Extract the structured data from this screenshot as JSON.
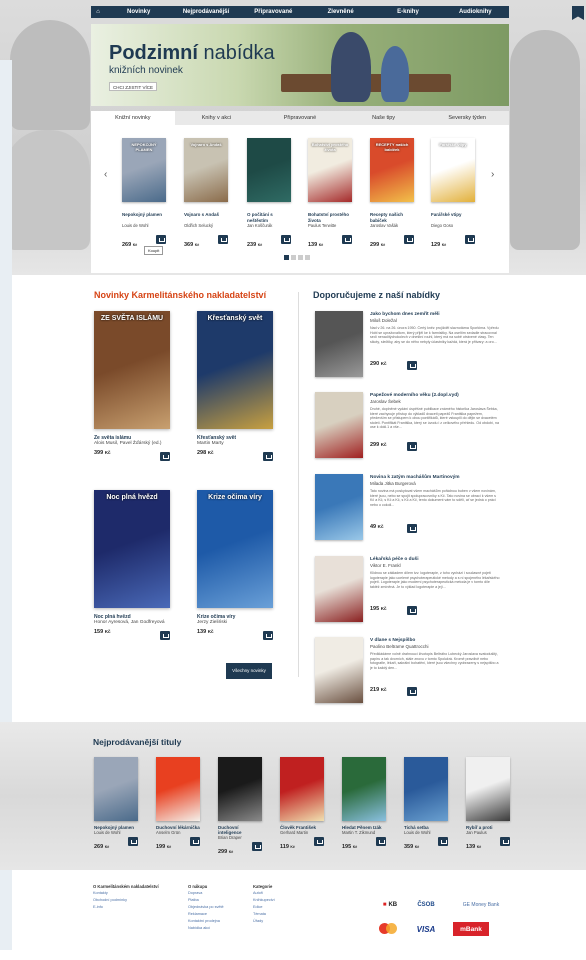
{
  "nav": {
    "items": [
      "Novinky",
      "Nejprodávanější",
      "Připravované",
      "Zlevněné",
      "E-knihy",
      "Audioknihy"
    ]
  },
  "hero": {
    "title_bold": "Podzimní",
    "title_rest": "nabídka",
    "subtitle": "knižních novinek",
    "button": "CHCI ZJISTIT VÍCE"
  },
  "tabs": [
    "Knižní novinky",
    "Knihy v akci",
    "Připravované",
    "Naše tipy",
    "Seversky týden"
  ],
  "carousel": {
    "prev": "‹",
    "next": "›",
    "items": [
      {
        "title": "Nepokojný plamen",
        "author": "Louis de Wohl",
        "price": "269",
        "colors": [
          "#9aa6b8",
          "#4a6a8a"
        ],
        "cover_text": "NEPOKOJNÝ PLAMEN"
      },
      {
        "title": "Vojnaro s Andaš",
        "author": "Oldřich Selucký",
        "price": "369",
        "colors": [
          "#c8c2b2",
          "#8a6b4a"
        ],
        "cover_text": "Vojnaro s Andaš"
      },
      {
        "title": "O počítání s neštěstím",
        "author": "Jan Koščurák",
        "price": "239",
        "colors": [
          "#1e4a46",
          "#2f6b64"
        ],
        "cover_text": ""
      },
      {
        "title": "Bohatství prostého života",
        "author": "Paulus Terwitte",
        "price": "139",
        "colors": [
          "#f1ece0",
          "#a52a2a"
        ],
        "cover_text": "Bohatství prostého života"
      },
      {
        "title": "Recepty našich babiček",
        "author": "Jaroslav Vašák",
        "price": "299",
        "colors": [
          "#d94b2b",
          "#f2c14a"
        ],
        "cover_text": "RECEPTY našich babiček"
      },
      {
        "title": "Farářské vtipy",
        "author": "Diego Goso",
        "price": "129",
        "colors": [
          "#ffffff",
          "#e2b03a"
        ],
        "cover_text": "Farářské vtipy"
      }
    ],
    "tooltip": "Koupit"
  },
  "currency": "Kč",
  "novinky": {
    "heading": "Novinky Karmelitánského nakladatelství",
    "items": [
      {
        "title": "Ze světa islámu",
        "author": "Alois Musil, Pavel Žďárský (ed.)",
        "price": "399",
        "colors": [
          "#7a4a2a",
          "#c8a070"
        ],
        "cover_text": "ZE SVĚTA ISLÁMU"
      },
      {
        "title": "Křesťanský svět",
        "author": "Martin Marty",
        "price": "298",
        "colors": [
          "#1e3a6a",
          "#c8a040"
        ],
        "cover_text": "Křesťanský svět"
      },
      {
        "title": "Noc plná hvězd",
        "author": "Honor Ayresová, Jan Godfreyová",
        "price": "159",
        "colors": [
          "#1e2a6a",
          "#4a6ab8"
        ],
        "cover_text": "Noc plná hvězd"
      },
      {
        "title": "Krize očima víry",
        "author": "Jerzy Zieliński",
        "price": "139",
        "colors": [
          "#1e5aa8",
          "#6aa0d8"
        ],
        "cover_text": "Krize očima víry"
      }
    ],
    "more": "Všechny novinky"
  },
  "doporucujeme": {
    "heading": "Doporučujeme z naší nabídky",
    "items": [
      {
        "title": "Jako bychom dnes zemřít měli",
        "author": "Miloš Doležal",
        "price": "290",
        "colors": [
          "#555555",
          "#999999"
        ],
        "desc": "Nad v 26. na 26. února 1950. Čertý kněz projížděl slavnotárna Sporkima. Vpředu Hobl se upražovaltom, který přijěl ke k farmisitky. Na oseltím sedadle stracovnal sedí nenadítýchokolech v dneštní rouhl, který má na sobě otrávené vlasy. Ten sikoty, slečtiky, aby se do něho nebyly účastniky každá, která je přitvary: a oro..."
      },
      {
        "title": "Papežové moderního věku (2.dopl.vyd)",
        "author": "Jaroslav Šebek",
        "price": "299",
        "colors": [
          "#d8d0c0",
          "#a02020"
        ],
        "desc": "Druhé, doplněné vydání úspěšné publikace známého historika Jaroslava Šebka, které zachycuje přístup do výkladů dvaceti papežů Františka papežem, především se přístupem k obou pontifikátů, které vstoupili do dějin se dvacetém století. Pontifikát Františka, který se úvodu i z celkového přehledu. Od období, na ose k dokl.1 a vše..."
      },
      {
        "title": "Novina k zatým machášům Martinovým",
        "author": "Milada Jitka Burgerová",
        "price": "49",
        "colors": [
          "#3a78b8",
          "#9ac8e8"
        ],
        "desc": "Tato novina má poskytovat všem machášům pořádnou buben v všem novinám, které jsou, nebo se spojit spolupracovníky s Kč. Tato novina se obrací k všem s Kč a Kč, s Kč a Kč, s Kč a Kč, tento dokument vám to sdělí, ať se jedná o práci nebo o cokoli..."
      },
      {
        "title": "Lékařská péče o duši",
        "author": "Viktor E. Frankl",
        "price": "195",
        "colors": [
          "#e8e0d8",
          "#8a2020"
        ],
        "desc": "Klidnou se základem dílem tzv. logoterapie, z toho vychází i současné pojetí logoterapie jako ucelené psychoterapeutické metody a s ní spojeného lékařského pojetí. Logoterapie jako moderní psychoterapeutická metoda je v tomto díle taktéž zmíněná. Je to výklad logoterapie a její..."
      },
      {
        "title": "V dlane s Nejspíšbo",
        "author": "Paolino Beltrame Quattrocchi",
        "price": "219",
        "colors": [
          "#f0ece4",
          "#6a5040"
        ],
        "desc": "Předkládáme volně drahnoucí životopis Beltráho Lubecký Jaroslava svatodušitý, papíru a tak dvorních, stále znovu v tomto Spolukrá. Kromě pravdivě nebo fotografie, lékaři, sakrální bohatění, které jsou všechny vyobrazeny s nejspíšbo a je to každý den..."
      }
    ]
  },
  "bestsellers": {
    "heading": "Nejprodávanější tituly",
    "items": [
      {
        "title": "Nepokojný plamen",
        "author": "Louis de Wohl",
        "price": "269",
        "colors": [
          "#9aa6b8",
          "#4a6a8a"
        ]
      },
      {
        "title": "Duchovní lékárnička",
        "author": "Anselm Grün",
        "price": "199",
        "colors": [
          "#e84020",
          "#f4f0ea"
        ]
      },
      {
        "title": "Duchovní inteligence",
        "author": "Brian Draper",
        "price": "299",
        "colors": [
          "#1a1a1a",
          "#8a8a8a"
        ]
      },
      {
        "title": "Člověk František",
        "author": "Gerhard Martin",
        "price": "119",
        "colors": [
          "#c02020",
          "#f0e0b0"
        ]
      },
      {
        "title": "Hledat Pěnem Izák",
        "author": "Martin T. Zikmund",
        "price": "195",
        "colors": [
          "#2a6a3a",
          "#8ac0e0"
        ]
      },
      {
        "title": "Tichá setba",
        "author": "Louis de Wohl",
        "price": "359",
        "colors": [
          "#2a5a9a",
          "#6aa0d0"
        ]
      },
      {
        "title": "Rybíř a proti",
        "author": "Jan Paulus",
        "price": "139",
        "colors": [
          "#f0f0f0",
          "#3a3a3a"
        ]
      }
    ]
  },
  "footer": {
    "col1": {
      "heading": "O Karmelitánském nakladatelství",
      "links": [
        "Kontakty",
        "Obchodní podmínky",
        "E-info"
      ]
    },
    "col2": {
      "heading": "O nákupu",
      "links": [
        "Doprava",
        "Platba",
        "Objednávka po světě",
        "Reklamace",
        "Kontaktní prodejna",
        "Nabídka akcí"
      ]
    },
    "col3": {
      "heading": "Kategorie",
      "links": [
        "Autoři",
        "Knihkupectví",
        "Edice",
        "Témata",
        "Úřady"
      ]
    },
    "payments": [
      "KB",
      "ČSOB",
      "GE Money Bank",
      "MasterCard",
      "VISA",
      "mBank"
    ]
  }
}
